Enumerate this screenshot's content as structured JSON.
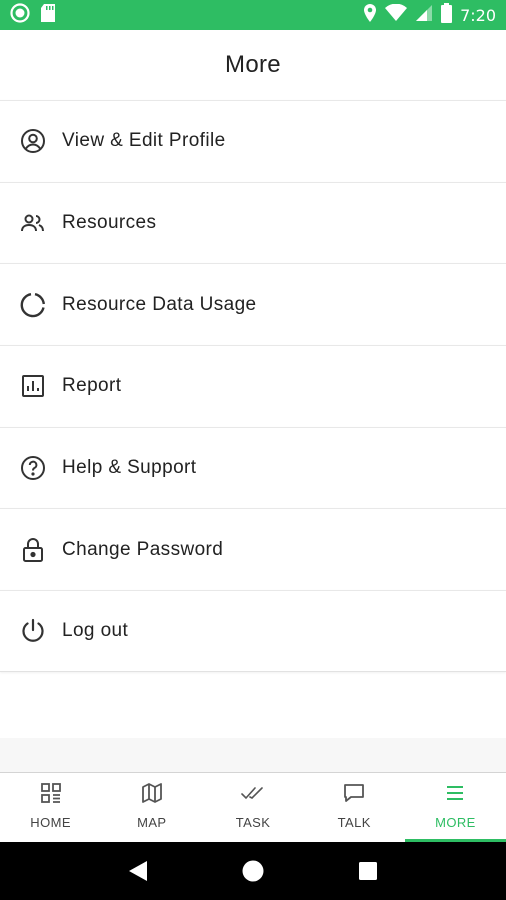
{
  "status_bar": {
    "time": "7:20",
    "icons": [
      "circle-notification-icon",
      "sd-card-icon",
      "location-icon",
      "wifi-icon",
      "signal-icon",
      "battery-icon"
    ],
    "background": "#2ebd63"
  },
  "header": {
    "title": "More"
  },
  "menu": {
    "items": [
      {
        "label": "View & Edit Profile",
        "icon": "account-circle-icon"
      },
      {
        "label": "Resources",
        "icon": "people-icon"
      },
      {
        "label": "Resource Data Usage",
        "icon": "data-usage-icon"
      },
      {
        "label": "Report",
        "icon": "bar-chart-icon"
      },
      {
        "label": "Help & Support",
        "icon": "help-circle-icon"
      },
      {
        "label": "Change Password",
        "icon": "lock-icon"
      },
      {
        "label": "Log out",
        "icon": "power-icon"
      }
    ]
  },
  "bottom_nav": {
    "tabs": [
      {
        "label": "HOME",
        "icon": "grid-icon"
      },
      {
        "label": "MAP",
        "icon": "map-icon"
      },
      {
        "label": "TASK",
        "icon": "double-check-icon"
      },
      {
        "label": "TALK",
        "icon": "chat-bubble-icon"
      },
      {
        "label": "MORE",
        "icon": "menu-icon"
      }
    ],
    "active": "MORE",
    "accent": "#2ebd63"
  },
  "system_nav": {
    "icons": [
      "back-icon",
      "home-circle-icon",
      "recents-icon"
    ]
  }
}
